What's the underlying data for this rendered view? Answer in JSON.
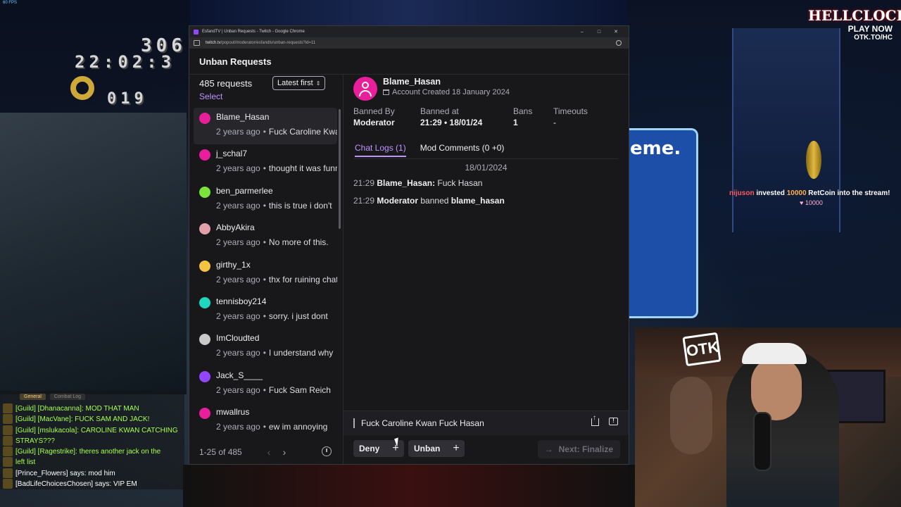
{
  "browser": {
    "title": "EsfandTV | Unban Requests - Twitch - Google Chrome",
    "url_host": "twitch.tv",
    "url_path": "/popout/moderator/esfandtv/unban-requests?id=11"
  },
  "app": {
    "title": "Unban Requests"
  },
  "list_panel": {
    "count": "485 requests",
    "sort_label": "Latest first",
    "select_label": "Select",
    "items": [
      {
        "name": "Blame_Hasan",
        "time": "2 years ago",
        "message": "Fuck Caroline Kwan",
        "avatar_color": "#e91e9b"
      },
      {
        "name": "j_schal7",
        "time": "2 years ago",
        "message": "thought it was funny",
        "avatar_color": "#e91e9b"
      },
      {
        "name": "ben_parmerlee",
        "time": "2 years ago",
        "message": "this is true i don't",
        "avatar_color": "#7be33a"
      },
      {
        "name": "AbbyAkira",
        "time": "2 years ago",
        "message": "No more of this.",
        "avatar_color": "#e2a0a8"
      },
      {
        "name": "girthy_1x",
        "time": "2 years ago",
        "message": "thx for ruining chat",
        "avatar_color": "#f5c242"
      },
      {
        "name": "tennisboy214",
        "time": "2 years ago",
        "message": "sorry. i just dont",
        "avatar_color": "#1ed9c0"
      },
      {
        "name": "ImCloudted",
        "time": "2 years ago",
        "message": "I understand why",
        "avatar_color": "#c9c9c9"
      },
      {
        "name": "Jack_S____",
        "time": "2 years ago",
        "message": "Fuck Sam Reich",
        "avatar_color": "#9147ff"
      },
      {
        "name": "mwallrus",
        "time": "2 years ago",
        "message": "ew im annoying",
        "avatar_color": "#e91e9b"
      }
    ],
    "pager": {
      "range": "1-25 of 485"
    }
  },
  "detail": {
    "username": "Blame_Hasan",
    "account_created": "Account Created 18 January 2024",
    "avatar_color": "#e91e9b",
    "stats": [
      {
        "label": "Banned By",
        "value": "Moderator"
      },
      {
        "label": "Banned at",
        "value": "21:29 • 18/01/24"
      },
      {
        "label": "Bans",
        "value": "1"
      },
      {
        "label": "Timeouts",
        "value": "-"
      }
    ],
    "tabs": {
      "chat_logs": "Chat Logs (1)",
      "mod_comments": "Mod Comments (0 +0)"
    },
    "log_date": "18/01/2024",
    "logs": [
      {
        "time": "21:29",
        "user": "Blame_Hasan:",
        "text": " Fuck Hasan"
      },
      {
        "time": "21:29",
        "user": "Moderator",
        "text": " banned ",
        "target": "blame_hasan"
      }
    ],
    "request_reason": "Fuck Caroline Kwan Fuck Hasan",
    "actions": {
      "deny": "Deny",
      "unban": "Unban",
      "next": "Next: Finalize"
    }
  },
  "stream_overlay": {
    "hud_score": "306",
    "hud_time": "22:02:3",
    "hud_rings": "019",
    "dialog_text": "eme.",
    "invest_user": "nijuson",
    "invest_text_a": " invested ",
    "invest_amount": "10000",
    "invest_text_b": " RetCoin into the stream!",
    "invest_sub": "10000",
    "brand_top": "HELLCLOCK",
    "brand_mid": "PLAY NOW",
    "brand_bot": "OTK.TO/HC",
    "webcam_logo": "OTK",
    "fps": "60 FPS",
    "game_chat_tabs": [
      "General",
      "Combat Log"
    ],
    "game_chat": [
      {
        "kind": "guild",
        "text": "[Guild] [Dhanacanna]: MOD THAT MAN"
      },
      {
        "kind": "guild",
        "text": "[Guild] [MacVane]: FUCK SAM AND JACK!"
      },
      {
        "kind": "guild",
        "text": "[Guild] [mslukacola]: CAROLINE KWAN CATCHING"
      },
      {
        "kind": "guild",
        "text": "STRAYS???"
      },
      {
        "kind": "guild",
        "text": "[Guild] [Ragestrike]: theres another jack on the"
      },
      {
        "kind": "guild",
        "text": "left list"
      },
      {
        "kind": "say",
        "text": "[Prince_Flowers] says: mod him"
      },
      {
        "kind": "say",
        "text": "[BadLifeChoicesChosen] says: VIP EM"
      }
    ]
  }
}
